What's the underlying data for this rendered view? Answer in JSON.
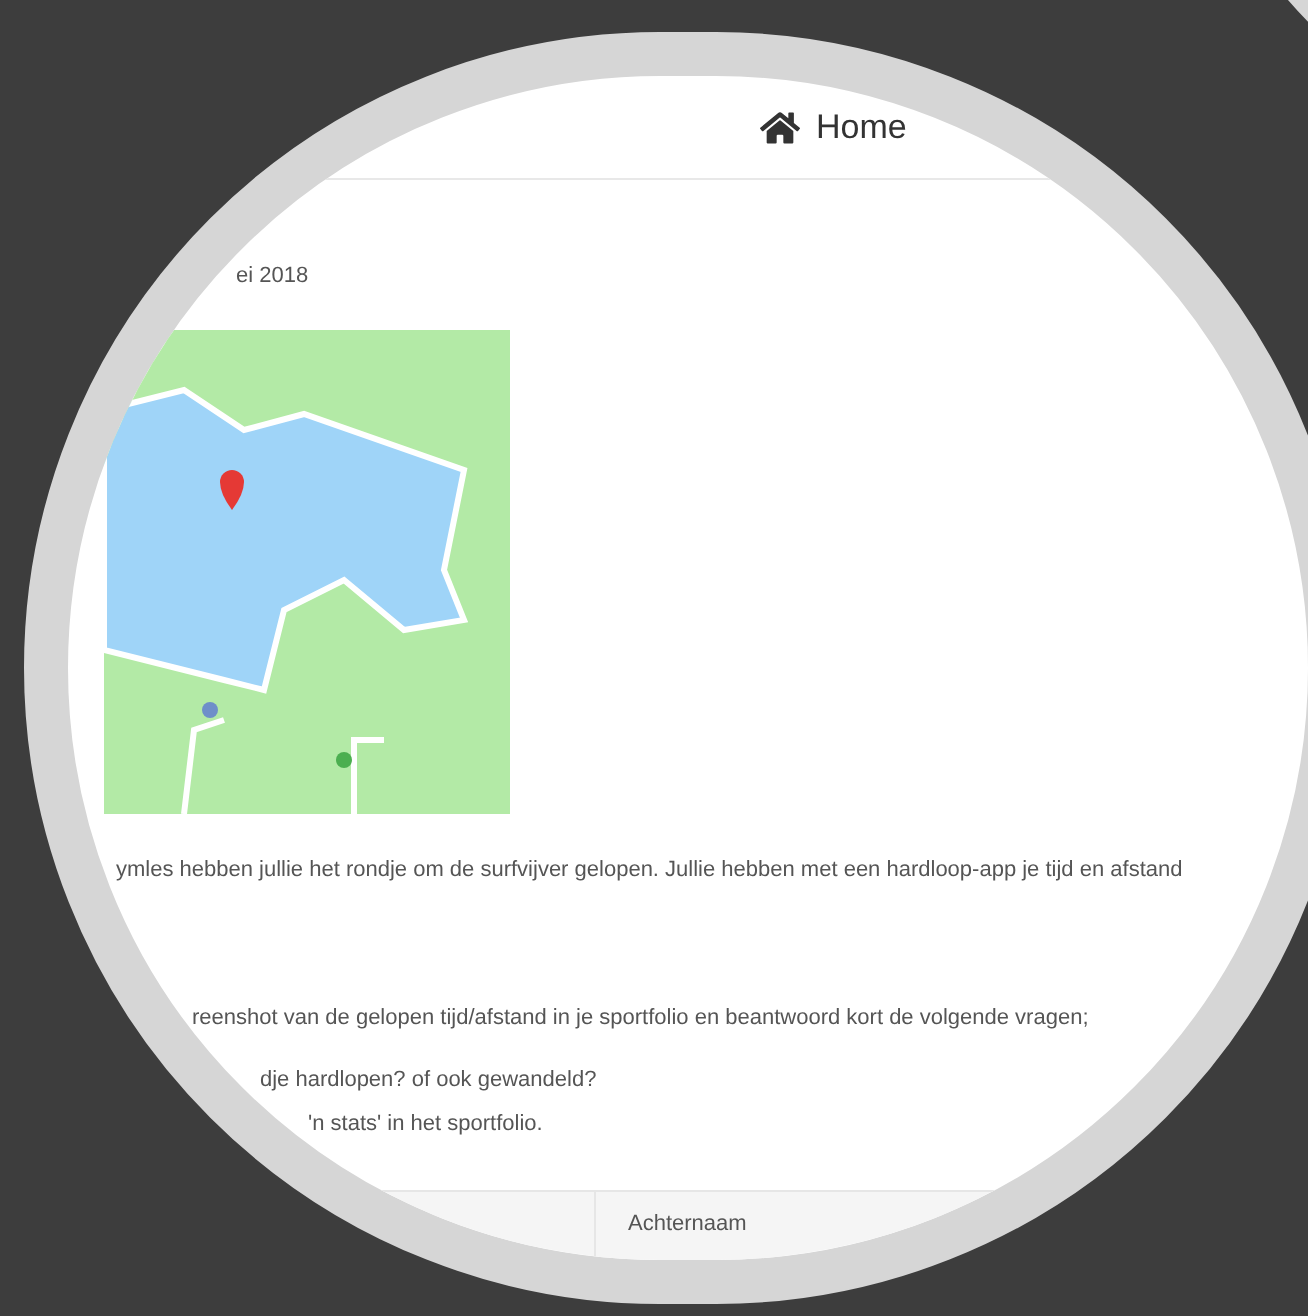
{
  "header": {
    "title": "Home"
  },
  "date": "ei 2018",
  "intro": "ymles hebben jullie het rondje om de surfvijver gelopen. Jullie hebben met een hardloop-app je tijd en afstand",
  "instruction": "reenshot van de gelopen tijd/afstand in je sportfolio en beantwoord kort de volgende vragen;",
  "questions": [
    "dje hardlopen? of ook gewandeld?",
    "'n stats' in het sportfolio."
  ],
  "table": {
    "columns": [
      "Achternaam"
    ]
  }
}
